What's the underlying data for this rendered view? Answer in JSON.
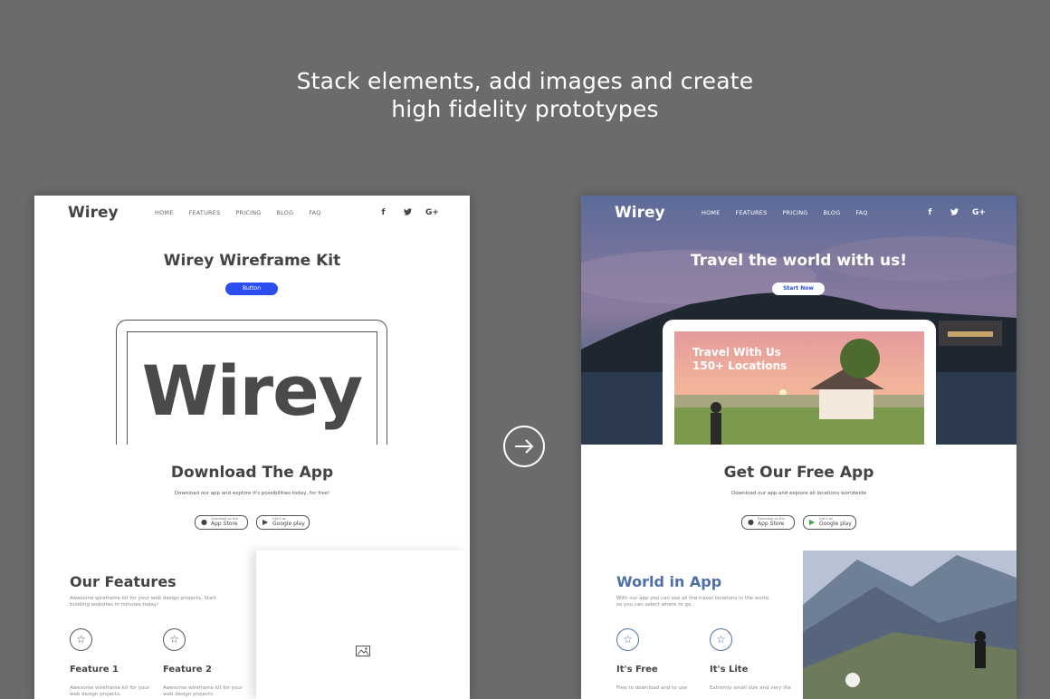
{
  "headline": {
    "line1": "Stack elements, add images and create",
    "line2": "high fidelity prototypes"
  },
  "nav": {
    "logo": "Wirey",
    "links": [
      "HOME",
      "FEATURES",
      "PRICING",
      "BLOG",
      "FAQ"
    ],
    "social": [
      "f",
      "t",
      "G+"
    ]
  },
  "wireframe": {
    "hero_title": "Wirey Wireframe Kit",
    "button": "Button",
    "device_word": "Wirey",
    "section_title": "Download The App",
    "section_sub": "Download our app and explore it's possibilities today, for free!",
    "features_title": "Our Features",
    "features_desc": "Awesome wireframe kit for your web design projects. Start building websites in minutes today!",
    "features": [
      {
        "name": "Feature 1",
        "text": "Awesome wireframe kit for your web design projects."
      },
      {
        "name": "Feature 2",
        "text": "Awesome wireframe kit for your web design projects."
      }
    ]
  },
  "final": {
    "hero_title": "Travel the world with us!",
    "button": "Start Now",
    "screen_text_1": "Travel With Us",
    "screen_text_2": "150+ Locations",
    "section_title": "Get Our Free App",
    "section_sub": "Download our app and explore all locations worldwide",
    "features_title": "World in App",
    "features_desc": "With our app you can see all the travel locations in the world, so you can select where to go.",
    "features": [
      {
        "name": "It's Free",
        "text": "Free to download and to use"
      },
      {
        "name": "It's Lite",
        "text": "Extremly small size and very lite"
      }
    ]
  },
  "stores": {
    "apple_small": "Download on the",
    "apple_big": "App Store",
    "google_small": "Get it on",
    "google_big": "Google play"
  },
  "colors": {
    "background": "#6a6b6d",
    "primary_button": "#2c4ef0",
    "accent_blue": "#4e6fa8"
  },
  "icons": [
    "arrow-right-icon",
    "star-icon",
    "image-placeholder-icon",
    "apple-icon",
    "google-play-icon",
    "facebook-icon",
    "twitter-icon",
    "google-plus-icon"
  ]
}
